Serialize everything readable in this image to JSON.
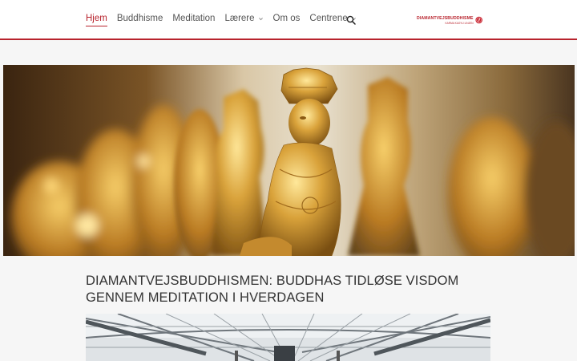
{
  "nav": {
    "items": [
      {
        "label": "Hjem",
        "active": true,
        "dropdown": false
      },
      {
        "label": "Buddhisme",
        "active": false,
        "dropdown": false
      },
      {
        "label": "Meditation",
        "active": false,
        "dropdown": false
      },
      {
        "label": "Lærere",
        "active": false,
        "dropdown": true
      },
      {
        "label": "Om os",
        "active": false,
        "dropdown": false
      },
      {
        "label": "Centrene",
        "active": false,
        "dropdown": true
      }
    ],
    "search_icon": "search-icon"
  },
  "logo": {
    "main": "DIAMANTVEJSBUDDHISME",
    "sub": "KARMA KAGYU LINJEN"
  },
  "colors": {
    "accent": "#b8232d",
    "background": "#f6f6f6",
    "header": "#ffffff",
    "text": "#333333"
  },
  "main": {
    "heading": "DIAMANTVEJSBUDDHISMEN: BUDDHAS TIDLØSE VISDOM GENNEM MEDITATION I HVERDAGEN"
  }
}
